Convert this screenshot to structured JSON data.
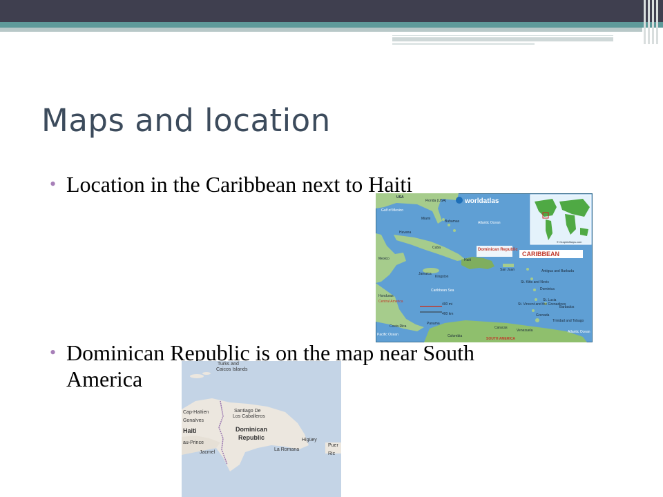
{
  "slide": {
    "title": "Maps and location",
    "bullets": [
      {
        "text": "Location in the Caribbean next to Haiti"
      },
      {
        "line1": "Dominican Republic is on the map near South",
        "line2": "America"
      }
    ]
  },
  "caribbean_map": {
    "brand": "worldatlas",
    "banner": "CARIBBEAN",
    "labels": {
      "usa": "USA",
      "gulf": "Gulf of Mexico",
      "florida": "Florida (USA)",
      "miami": "Miami",
      "bahamas": "Bahamas",
      "atlantic_top": "Atlantic Ocean",
      "havana": "Havana",
      "cuba": "Cuba",
      "mexico": "Mexico",
      "dr": "Dominican Republic",
      "haiti": "Haiti",
      "san_juan": "San Juan",
      "jamaica": "Jamaica",
      "kingston": "Kingston",
      "antigua": "Antigua and Barbuda",
      "st_kitts": "St. Kitts and Nevis",
      "dominica": "Dominica",
      "caribbean_sea": "Caribbean Sea",
      "st_lucia": "St. Lucia",
      "barbados": "Barbados",
      "honduras": "Honduras",
      "central_america": "Central America",
      "st_vincent": "St. Vincent and the Grenadines",
      "grenada": "Grenada",
      "scale_mi": "400 mi",
      "scale_km": "400 km",
      "trinidad": "Trinidad and Tobago",
      "panama": "Panama",
      "caracas": "Caracas",
      "venezuela": "Venezuela",
      "costa_rica": "Costa Rica",
      "pacific": "Pacific Ocean",
      "colombia": "Colombia",
      "south_america": "SOUTH AMERICA",
      "atlantic_bottom": "Atlantic Ocean",
      "credit": "© GraphicMaps.com"
    }
  },
  "hispaniola_map": {
    "labels": {
      "turks1": "Turks and",
      "turks2": "Caicos Islands",
      "santiago1": "Santiago De",
      "santiago2": "Los Caballeros",
      "cap_haitien": "Cap-Haïtien",
      "gonaives": "Gonaïves",
      "haiti": "Haiti",
      "dominican": "Dominican",
      "republic": "Republic",
      "port_au_prince": "au-Prince",
      "jacmel": "Jacmel",
      "higuey": "Higüey",
      "la_romana": "La Romana",
      "puerto1": "Puer",
      "puerto2": "Ric"
    }
  }
}
